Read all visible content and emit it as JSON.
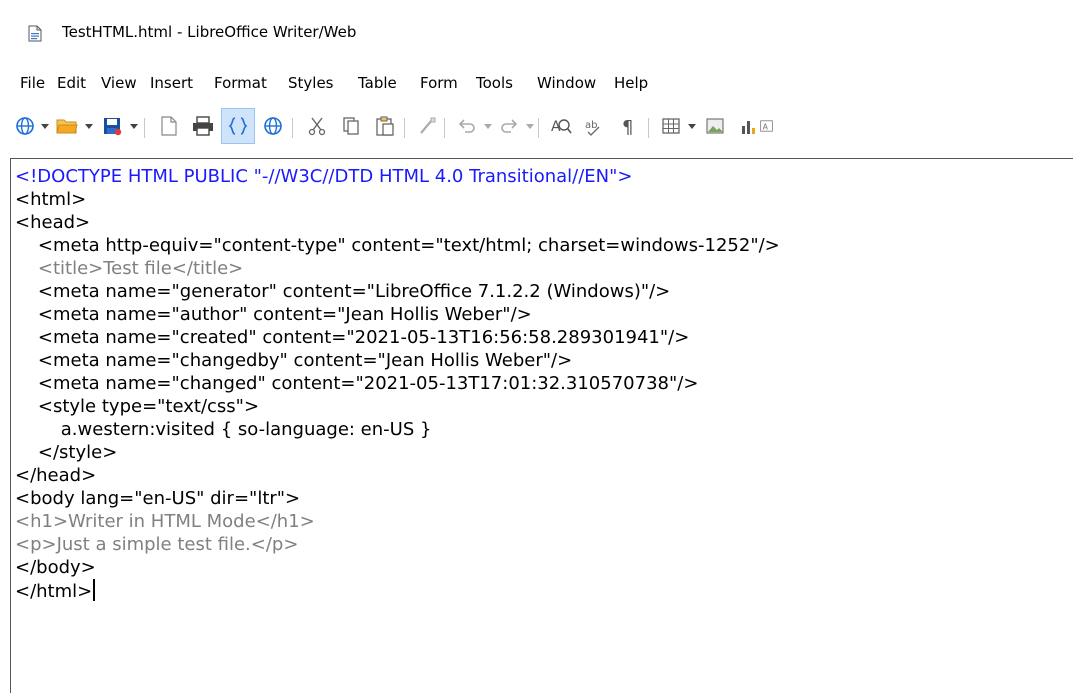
{
  "window": {
    "title": "TestHTML.html - LibreOffice Writer/Web"
  },
  "menu": [
    "File",
    "Edit",
    "View",
    "Insert",
    "Format",
    "Styles",
    "Table",
    "Form",
    "Tools",
    "Window",
    "Help"
  ],
  "toolbar": {
    "icons": [
      "web-view-icon",
      "open-folder-icon",
      "save-icon",
      "export-pdf-icon",
      "print-icon",
      "html-source-icon",
      "web-browser-icon",
      "cut-icon",
      "copy-icon",
      "paste-icon",
      "clone-formatting-icon",
      "undo-icon",
      "redo-icon",
      "find-replace-icon",
      "spelling-icon",
      "formatting-marks-icon",
      "insert-table-icon",
      "insert-image-icon",
      "insert-chart-icon",
      "insert-text-box-icon"
    ],
    "active": "html-source-icon"
  },
  "source": {
    "lines": [
      "<!DOCTYPE HTML PUBLIC \"-//W3C//DTD HTML 4.0 Transitional//EN\">",
      "<html>",
      "<head>",
      "    <meta http-equiv=\"content-type\" content=\"text/html; charset=windows-1252\"/>",
      "    <title>Test file</title>",
      "    <meta name=\"generator\" content=\"LibreOffice 7.1.2.2 (Windows)\"/>",
      "    <meta name=\"author\" content=\"Jean Hollis Weber\"/>",
      "    <meta name=\"created\" content=\"2021-05-13T16:56:58.289301941\"/>",
      "    <meta name=\"changedby\" content=\"Jean Hollis Weber\"/>",
      "    <meta name=\"changed\" content=\"2021-05-13T17:01:32.310570738\"/>",
      "    <style type=\"text/css\">",
      "        a.western:visited { so-language: en-US }",
      "    </style>",
      "</head>",
      "<body lang=\"en-US\" dir=\"ltr\">",
      "<h1>Writer in HTML Mode</h1>",
      "<p>Just a simple test file.</p>",
      "</body>",
      "</html>"
    ]
  },
  "colors": {
    "doctype": "#1a1aff",
    "dim": "#808080",
    "text": "#000000",
    "active_bg": "#cfe3fa"
  }
}
